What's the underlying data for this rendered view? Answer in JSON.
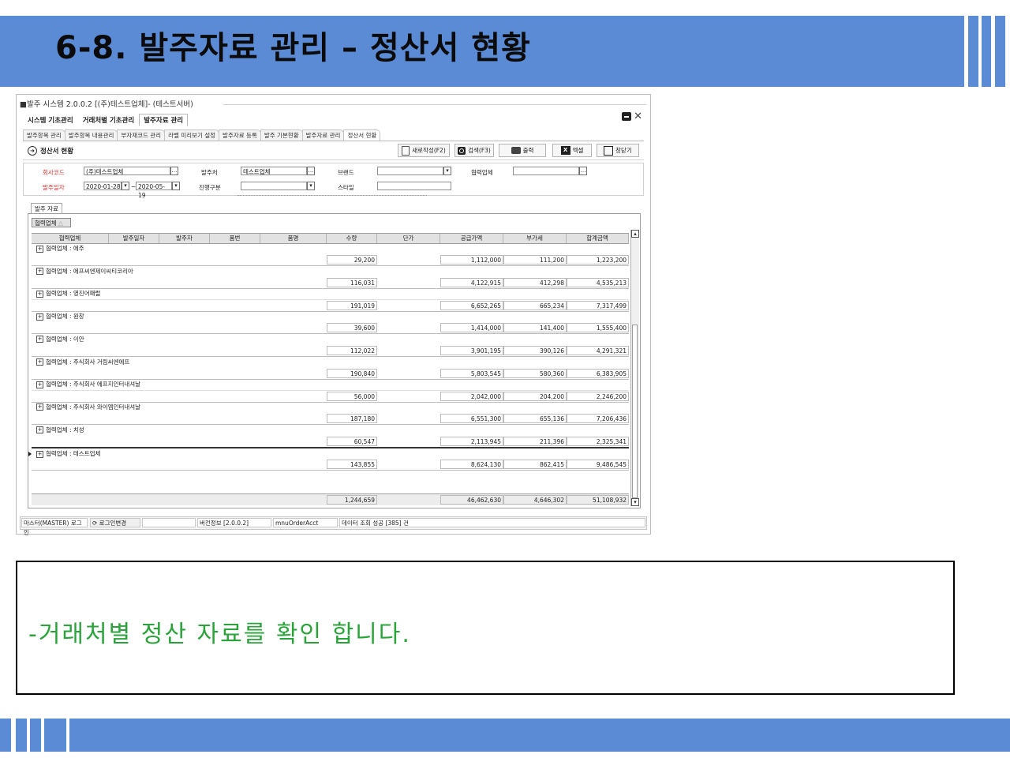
{
  "slide": {
    "title": "6-8. 발주자료 관리 – 정산서 현황",
    "note": "-거래처별 정산 자료를 확인 합니다.",
    "accent_color": "#5b8bd5",
    "note_color": "#2aa33a"
  },
  "window": {
    "title": "■발주 시스템 2.0.0.2 [(주)테스트업체]- (테스트서버)",
    "menu_tabs": [
      "시스템 기초관리",
      "거래처별 기초관리",
      "발주자료 관리"
    ],
    "active_menu": "발주자료 관리",
    "sub_tabs": [
      "발주항목 관리",
      "발주항목 내용관리",
      "부자재코드 관리",
      "라벨 미리보기 설정",
      "발주자료 등록",
      "발주 기본현황",
      "발주자료 관리",
      "정산서 현황"
    ],
    "active_sub": "정산서 현황",
    "page_title": "정산서 현황",
    "toolbar": {
      "new_label": "새로작성(F2)",
      "search_label": "검색(F3)",
      "print_label": "출력",
      "excel_label": "엑셀",
      "close_label": "창닫기"
    },
    "filter": {
      "company_code_label": "회사코드",
      "company_code_value": "(주)테스트업체",
      "order_date_label": "발주일자",
      "date_from": "2020-01-28",
      "date_sep": "~",
      "date_to": "2020-05-19",
      "orderer_label": "발주처",
      "orderer_value": "테스트업체",
      "progress_label": "진행구분",
      "progress_value": "",
      "brand_label": "브랜드",
      "brand_value": "",
      "style_label": "스타일",
      "style_value": "",
      "partner_label": "협력업체",
      "partner_value": ""
    },
    "grid_tab": "발주 자료",
    "group_by": "협력업체",
    "columns": [
      "협력업체",
      "발주일자",
      "발주자",
      "품번",
      "품명",
      "수량",
      "단가",
      "공급가액",
      "부가세",
      "합계금액"
    ],
    "groups": [
      {
        "label": "협력업체 : 에주",
        "qty": "29,200",
        "supply": "1,112,000",
        "vat": "111,200",
        "total": "1,223,200"
      },
      {
        "label": "협력업체 : 에프씨엔제이씨티코리아",
        "qty": "116,031",
        "supply": "4,122,915",
        "vat": "412,298",
        "total": "4,535,213"
      },
      {
        "label": "협력업체 : 영진어패럴",
        "qty": "191,019",
        "supply": "6,652,265",
        "vat": "665,234",
        "total": "7,317,499"
      },
      {
        "label": "협력업체 : 원창",
        "qty": "39,600",
        "supply": "1,414,000",
        "vat": "141,400",
        "total": "1,555,400"
      },
      {
        "label": "협력업체 : 이안",
        "qty": "112,022",
        "supply": "3,901,195",
        "vat": "390,126",
        "total": "4,291,321"
      },
      {
        "label": "협력업체 : 주식회사 거림씨엔에프",
        "qty": "190,840",
        "supply": "5,803,545",
        "vat": "580,360",
        "total": "6,383,905"
      },
      {
        "label": "협력업체 : 주식회사 에프지인터내셔날",
        "qty": "56,000",
        "supply": "2,042,000",
        "vat": "204,200",
        "total": "2,246,200"
      },
      {
        "label": "협력업체 : 주식회사 와이엠인터내셔날",
        "qty": "187,180",
        "supply": "6,551,300",
        "vat": "655,136",
        "total": "7,206,436"
      },
      {
        "label": "협력업체 : 치성",
        "qty": "60,547",
        "supply": "2,113,945",
        "vat": "211,396",
        "total": "2,325,341"
      },
      {
        "label": "협력업체 : 테스트업체",
        "qty": "143,855",
        "supply": "8,624,130",
        "vat": "862,415",
        "total": "9,486,545"
      }
    ],
    "totals": {
      "qty": "1,244,659",
      "supply": "46,462,630",
      "vat": "4,646,302",
      "total": "51,108,932"
    },
    "statusbar": {
      "user": "마스터(MASTER) 로그인",
      "login_change": "로그인변경",
      "version": "버전정보 [2.0.0.2]",
      "menu_id": "mnuOrderAcct",
      "message": "데이터 조회 성공 [385] 건"
    }
  }
}
